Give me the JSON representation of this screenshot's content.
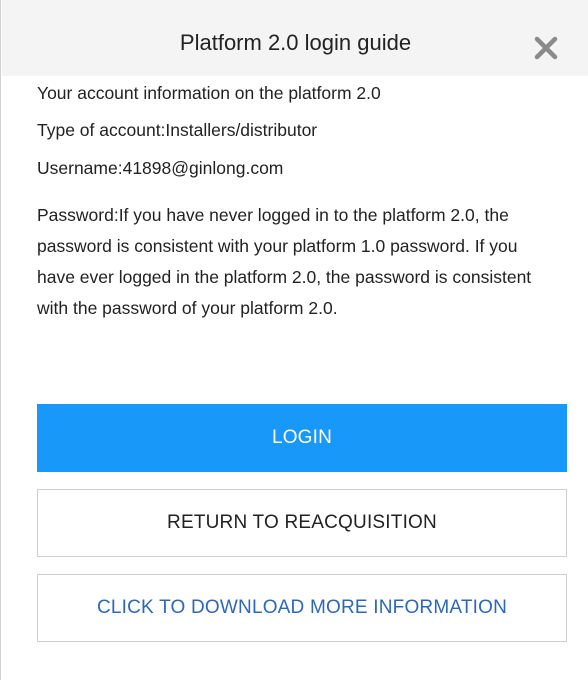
{
  "dialog": {
    "title": "Platform 2.0 login guide",
    "close_icon": "close-icon"
  },
  "info": {
    "heading": "Your account information on the platform 2.0",
    "account_type": "Type of account:Installers/distributor",
    "username": "Username:41898@ginlong.com",
    "password_note": "Password:If you have never logged in to the platform 2.0, the password is consistent with your platform 1.0 password. If you have ever logged in the platform 2.0, the password is consistent with the password of your platform 2.0."
  },
  "buttons": {
    "login": "LOGIN",
    "return": "RETURN TO REACQUISITION",
    "download": "CLICK TO DOWNLOAD MORE INFORMATION"
  },
  "colors": {
    "primary": "#1898f8",
    "link": "#2c68b8",
    "header_bg": "#f4f4f4",
    "border": "#cfcfcf"
  }
}
